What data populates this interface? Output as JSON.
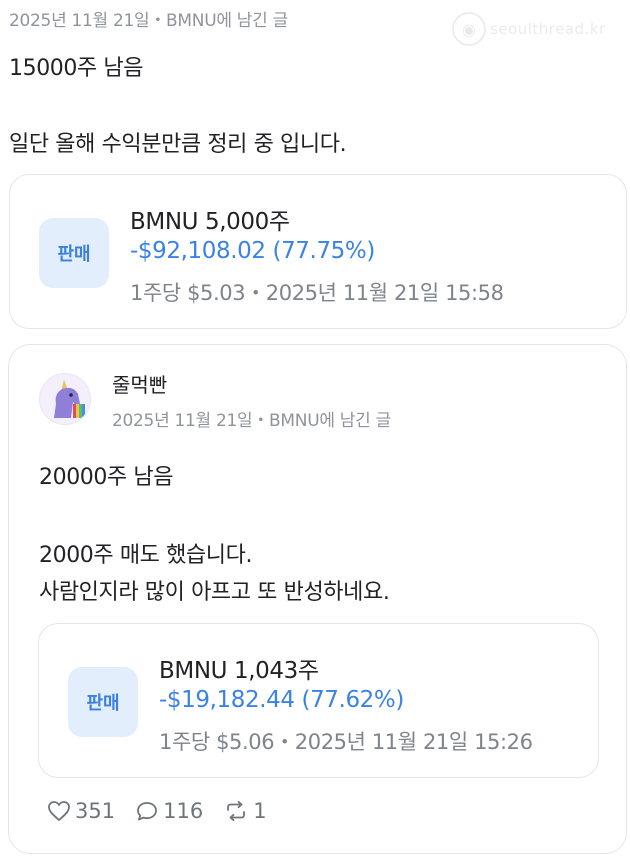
{
  "top": {
    "meta": "2025년 11월 21일・BMNU에 남긴 글",
    "watermark_text": "seoulthread.kr"
  },
  "post": {
    "line1": "15000주 남음",
    "line2": "일단 올해 수익분만큼 정리 중 입니다."
  },
  "trade1": {
    "badge": "판매",
    "title": "BMNU 5,000주",
    "pnl": "-$92,108.02 (77.75%)",
    "detail": "1주당 $5.03・2025년 11월 21일 15:58"
  },
  "quote": {
    "author": "줄먹빤",
    "meta": "2025년 11월 21일・BMNU에 남긴 글",
    "line1": "20000주 남음",
    "line2": "2000주 매도 했습니다.",
    "line3": "사람인지라 많이 아프고 또 반성하네요.",
    "trade": {
      "badge": "판매",
      "title": "BMNU 1,043주",
      "pnl": "-$19,182.44 (77.62%)",
      "detail": "1주당 $5.06・2025년 11월 21일 15:26"
    },
    "actions": {
      "likes": "351",
      "comments": "116",
      "reposts": "1"
    }
  },
  "colors": {
    "accent_blue": "#3b82e6",
    "badge_bg": "#e3eefc",
    "muted_text": "#8f949c",
    "border": "#e4e6ea"
  }
}
